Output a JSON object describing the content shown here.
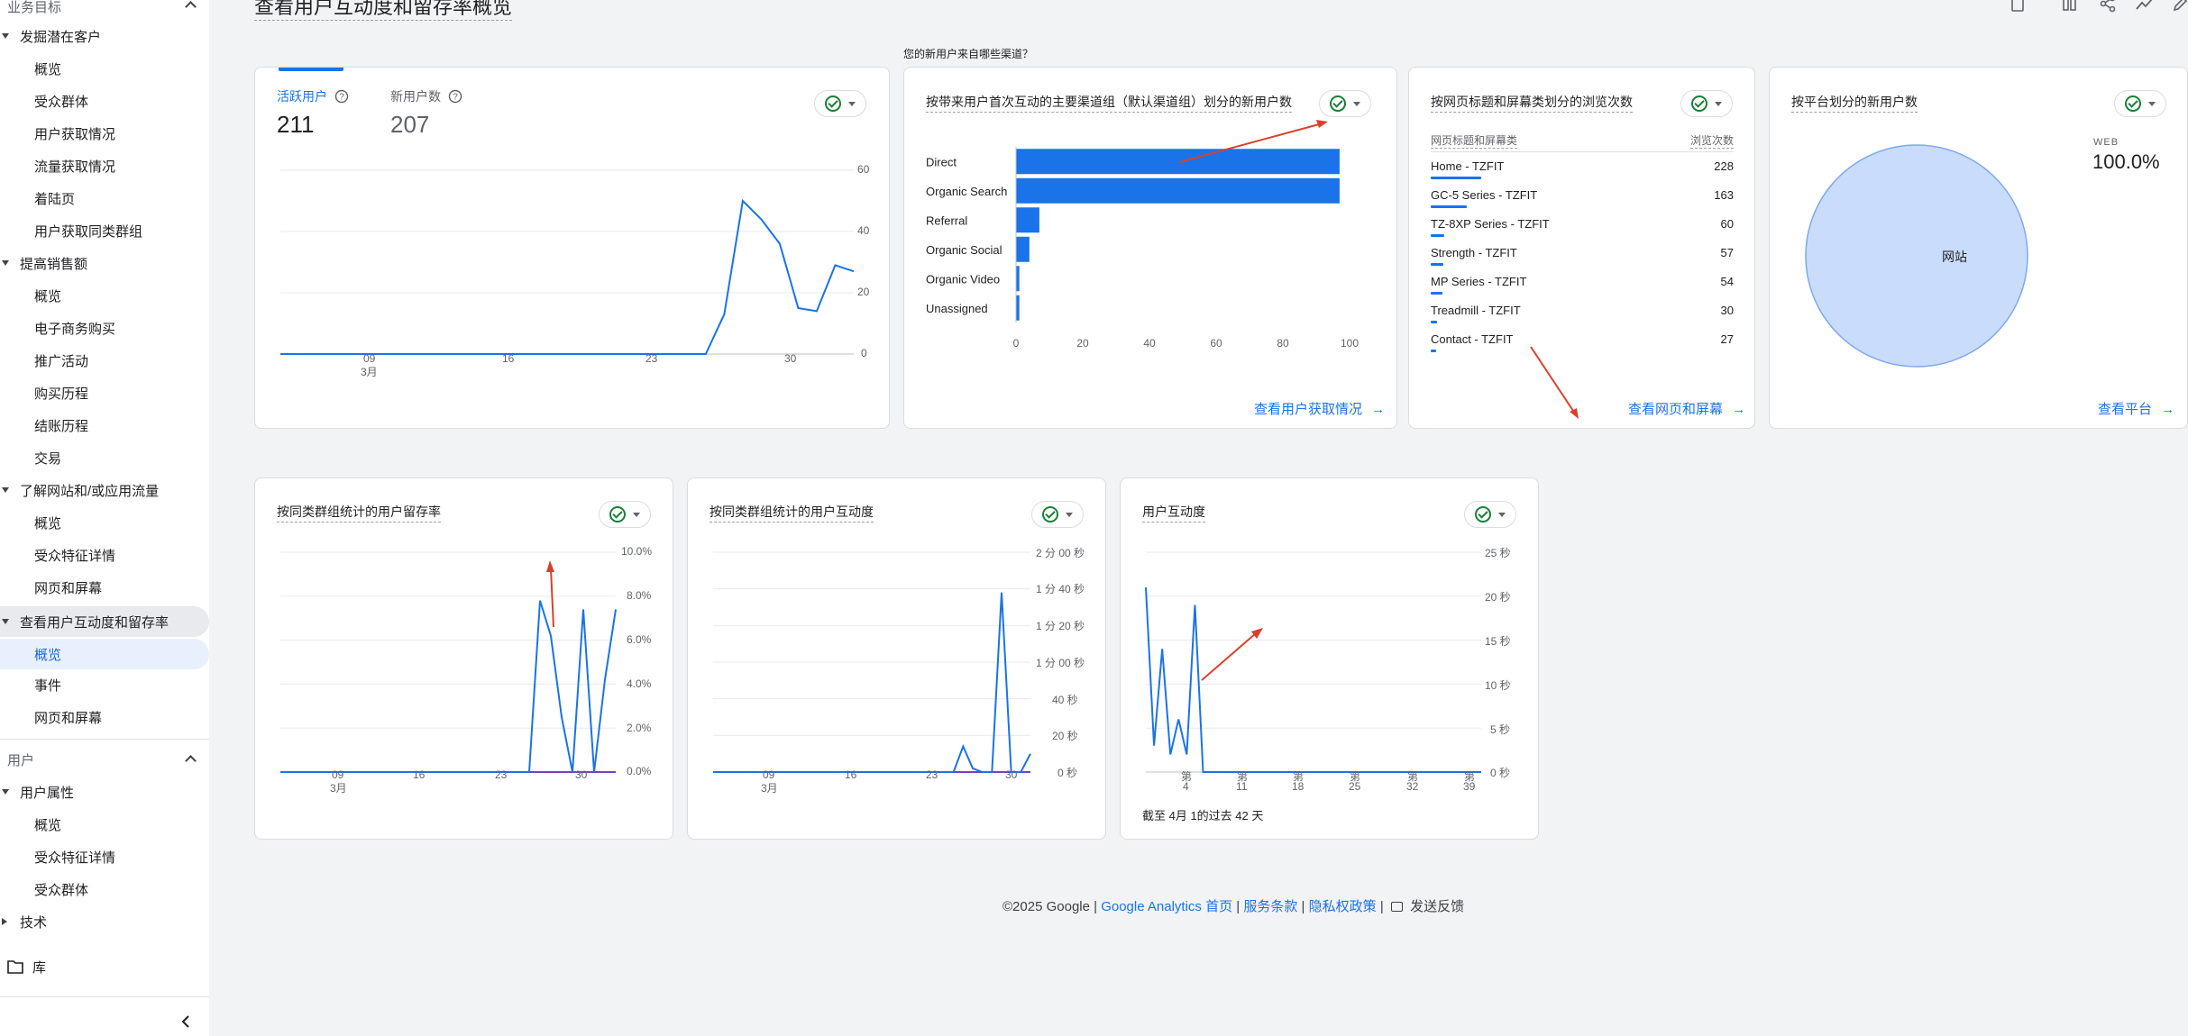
{
  "page": {
    "title": "查看用户互动度和留存率概览"
  },
  "sidebar": {
    "top_cut": "业务目标",
    "groups": [
      {
        "label": "发掘潜在客户",
        "items": [
          "概览",
          "受众群体",
          "用户获取情况",
          "流量获取情况",
          "着陆页",
          "用户获取同类群组"
        ]
      },
      {
        "label": "提高销售额",
        "items": [
          "概览",
          "电子商务购买",
          "推广活动",
          "购买历程",
          "结账历程",
          "交易"
        ]
      },
      {
        "label": "了解网站和/或应用流量",
        "items": [
          "概览",
          "受众特征详情",
          "网页和屏幕"
        ]
      },
      {
        "label": "查看用户互动度和留存率",
        "items": [
          "概览",
          "事件",
          "网页和屏幕"
        ]
      }
    ],
    "user_section": "用户",
    "user_group": {
      "label": "用户属性",
      "items": [
        "概览",
        "受众特征详情",
        "受众群体"
      ]
    },
    "tech": "技术",
    "library": "库"
  },
  "card1": {
    "tab1_label": "活跃用户",
    "tab1_value": "211",
    "tab2_label": "新用户数",
    "tab2_value": "207",
    "y_ticks": [
      "60",
      "40",
      "20",
      "0"
    ],
    "x_ticks": [
      "09",
      "16",
      "23",
      "30"
    ],
    "x_month": "3月"
  },
  "card2": {
    "question": "您的新用户来自哪些渠道？",
    "title": "按带来用户首次互动的主要渠道组（默认渠道组）划分的新用户数",
    "link": "查看用户获取情况",
    "x_ticks": [
      "0",
      "20",
      "40",
      "60",
      "80",
      "100"
    ]
  },
  "card3": {
    "title": "按网页标题和屏幕类划分的浏览次数",
    "col1": "网页标题和屏幕类",
    "col2": "浏览次数",
    "rows": [
      {
        "name": "Home - TZFIT",
        "value": "228"
      },
      {
        "name": "GC-5 Series - TZFIT",
        "value": "163"
      },
      {
        "name": "TZ-8XP Series - TZFIT",
        "value": "60"
      },
      {
        "name": "Strength - TZFIT",
        "value": "57"
      },
      {
        "name": "MP Series - TZFIT",
        "value": "54"
      },
      {
        "name": "Treadmill - TZFIT",
        "value": "30"
      },
      {
        "name": "Contact - TZFIT",
        "value": "27"
      }
    ],
    "link": "查看网页和屏幕"
  },
  "card4": {
    "title": "按平台划分的新用户数",
    "legend_label": "WEB",
    "legend_value": "100.0%",
    "slice_label": "网站",
    "link": "查看平台"
  },
  "card5": {
    "title": "按同类群组统计的用户留存率",
    "y_ticks": [
      "10.0%",
      "8.0%",
      "6.0%",
      "4.0%",
      "2.0%",
      "0.0%"
    ],
    "x_ticks": [
      "09",
      "16",
      "23",
      "30"
    ],
    "x_month": "3月"
  },
  "card6": {
    "title": "按同类群组统计的用户互动度",
    "y_ticks": [
      "2 分 00 秒",
      "1 分 40 秒",
      "1 分 20 秒",
      "1 分 00 秒",
      "40 秒",
      "20 秒",
      "0 秒"
    ],
    "x_ticks": [
      "09",
      "16",
      "23",
      "30"
    ],
    "x_month": "3月"
  },
  "card7": {
    "title": "用户互动度",
    "y_ticks": [
      "25 秒",
      "20 秒",
      "15 秒",
      "10 秒",
      "5 秒",
      "0 秒"
    ],
    "x_prefix": "第",
    "x_ticks": [
      "4",
      "11",
      "18",
      "25",
      "32",
      "39"
    ],
    "note": "截至 4月 1的过去 42 天"
  },
  "footer": {
    "copyright": "©2025 Google |",
    "home": "Google Analytics 首页",
    "sep1": "|",
    "terms": "服务条款",
    "sep2": "|",
    "privacy": "隐私权政策",
    "sep3": "|",
    "feedback": "发送反馈"
  },
  "chart_data": [
    {
      "type": "line",
      "x": [
        "3月2日",
        "3月3日",
        "3月4日",
        "3月5日",
        "3月6日",
        "3月7日",
        "3月8日",
        "3月9日",
        "3月10日",
        "3月11日",
        "3月12日",
        "3月13日",
        "3月14日",
        "3月15日",
        "3月16日",
        "3月17日",
        "3月18日",
        "3月19日",
        "3月20日",
        "3月21日",
        "3月22日",
        "3月23日",
        "3月24日",
        "3月25日",
        "3月26日",
        "3月27日",
        "3月28日",
        "3月29日",
        "3月30日",
        "3月31日",
        "4月1日"
      ],
      "series": [
        {
          "values": [
            0,
            0,
            0,
            0,
            0,
            0,
            0,
            0,
            0,
            0,
            0,
            0,
            0,
            0,
            0,
            0,
            0,
            0,
            0,
            0,
            0,
            0,
            0,
            0,
            13,
            50,
            44,
            36,
            15,
            14,
            29,
            27
          ]
        }
      ],
      "ylim": [
        0,
        60
      ]
    },
    {
      "type": "bar",
      "categories": [
        "Direct",
        "Organic Search",
        "Referral",
        "Organic Social",
        "Organic Video",
        "Unassigned"
      ],
      "values": [
        97,
        97,
        7,
        4,
        1,
        1
      ],
      "xlim": [
        0,
        100
      ]
    },
    {
      "type": "pie",
      "categories": [
        "网站"
      ],
      "values": [
        100
      ]
    },
    {
      "type": "line",
      "series": [
        {
          "values": [
            0,
            0,
            0,
            0,
            0,
            0,
            0,
            0,
            0,
            0,
            0,
            0,
            0,
            0,
            0,
            0,
            0,
            0,
            0,
            0,
            0,
            0,
            0,
            0,
            7.8,
            6.2,
            2.5,
            0,
            7.4,
            0,
            4.2,
            7.4
          ]
        }
      ],
      "ylim": [
        0,
        10
      ]
    },
    {
      "type": "line",
      "series": [
        {
          "values": [
            0,
            0,
            0,
            0,
            0,
            0,
            0,
            0,
            0,
            0,
            0,
            0,
            0,
            0,
            0,
            0,
            0,
            0,
            0,
            0,
            0,
            0,
            0,
            0,
            0,
            0,
            14,
            2,
            0,
            0,
            98,
            0,
            0,
            10
          ]
        }
      ],
      "ylim": [
        0,
        120
      ]
    },
    {
      "type": "line",
      "series": [
        {
          "values": [
            21,
            3,
            14,
            2,
            6,
            2,
            19,
            0,
            0,
            0,
            0,
            0,
            0,
            0,
            0,
            0,
            0,
            0,
            0,
            0,
            0,
            0,
            0,
            0,
            0,
            0,
            0,
            0,
            0,
            0,
            0,
            0,
            0,
            0,
            0,
            0,
            0,
            0,
            0,
            0,
            0,
            0
          ]
        }
      ],
      "ylim": [
        0,
        25
      ]
    }
  ]
}
